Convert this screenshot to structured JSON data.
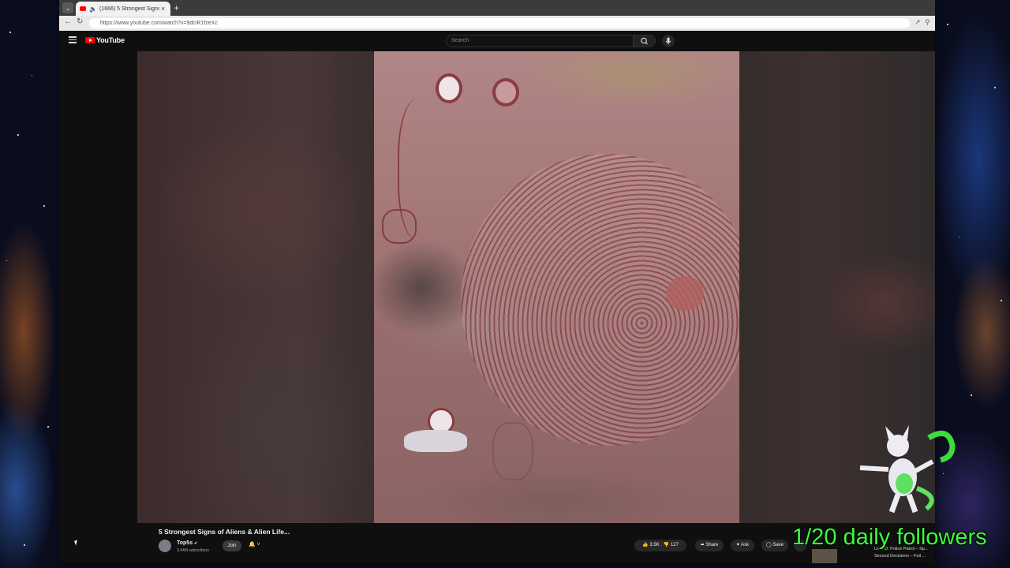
{
  "browser": {
    "tab_title": "(1666) 5 Strongest Signs of A",
    "tab_switch_icon": "chevron-down-icon",
    "url": "https://www.youtube.com/watch?v=9dciR1fzeXc"
  },
  "youtube": {
    "logo_text": "YouTube",
    "search_placeholder": "Search",
    "video": {
      "title": "5 Strongest Signs of Aliens & Alien Life...",
      "channel": "Top5s",
      "subscribers": "3.44M subscribers",
      "join_label": "Join",
      "likes": "3.5K",
      "dislikes": "127",
      "share_label": "Share",
      "ask_label": "Ask",
      "save_label": "Save"
    },
    "recommended": {
      "title_line1": "Live: D: Police Patrol – Sp...",
      "title_line2": "Second Decisions – Full ..."
    }
  },
  "overlay": {
    "followers_text": "1/20 daily followers",
    "accent_color": "#3dff3d"
  }
}
